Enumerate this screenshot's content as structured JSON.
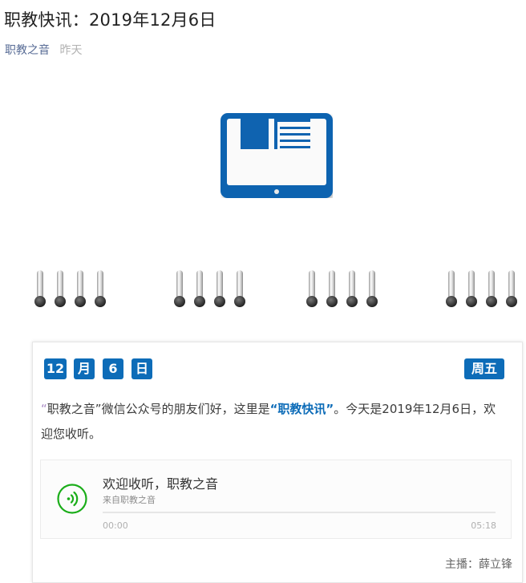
{
  "article": {
    "title": "职教快讯：2019年12月6日",
    "source": "职教之音",
    "date": "昨天"
  },
  "card": {
    "date_tags": [
      "12",
      "月",
      "6",
      "日"
    ],
    "weekday": "周五",
    "intro_quote_open": "“",
    "intro_name": "职教之音”",
    "intro_text1": "微信公众号的朋友们好，这里是",
    "intro_highlight": "“职教快讯”",
    "intro_text2": "。今天是2019年12月6日，欢迎您收听。",
    "host": "主播：薛立锋"
  },
  "audio": {
    "title": "欢迎收听，职教之音",
    "from": "来自职教之音",
    "current_time": "00:00",
    "duration": "05:18",
    "progress": 0
  },
  "colors": {
    "brand_blue": "#0d6cb8",
    "play_green": "#1aad19",
    "link": "#576b95"
  },
  "icons": {
    "tablet": "tablet-document-icon",
    "ring": "binder-ring-icon",
    "play": "audio-play-icon"
  }
}
